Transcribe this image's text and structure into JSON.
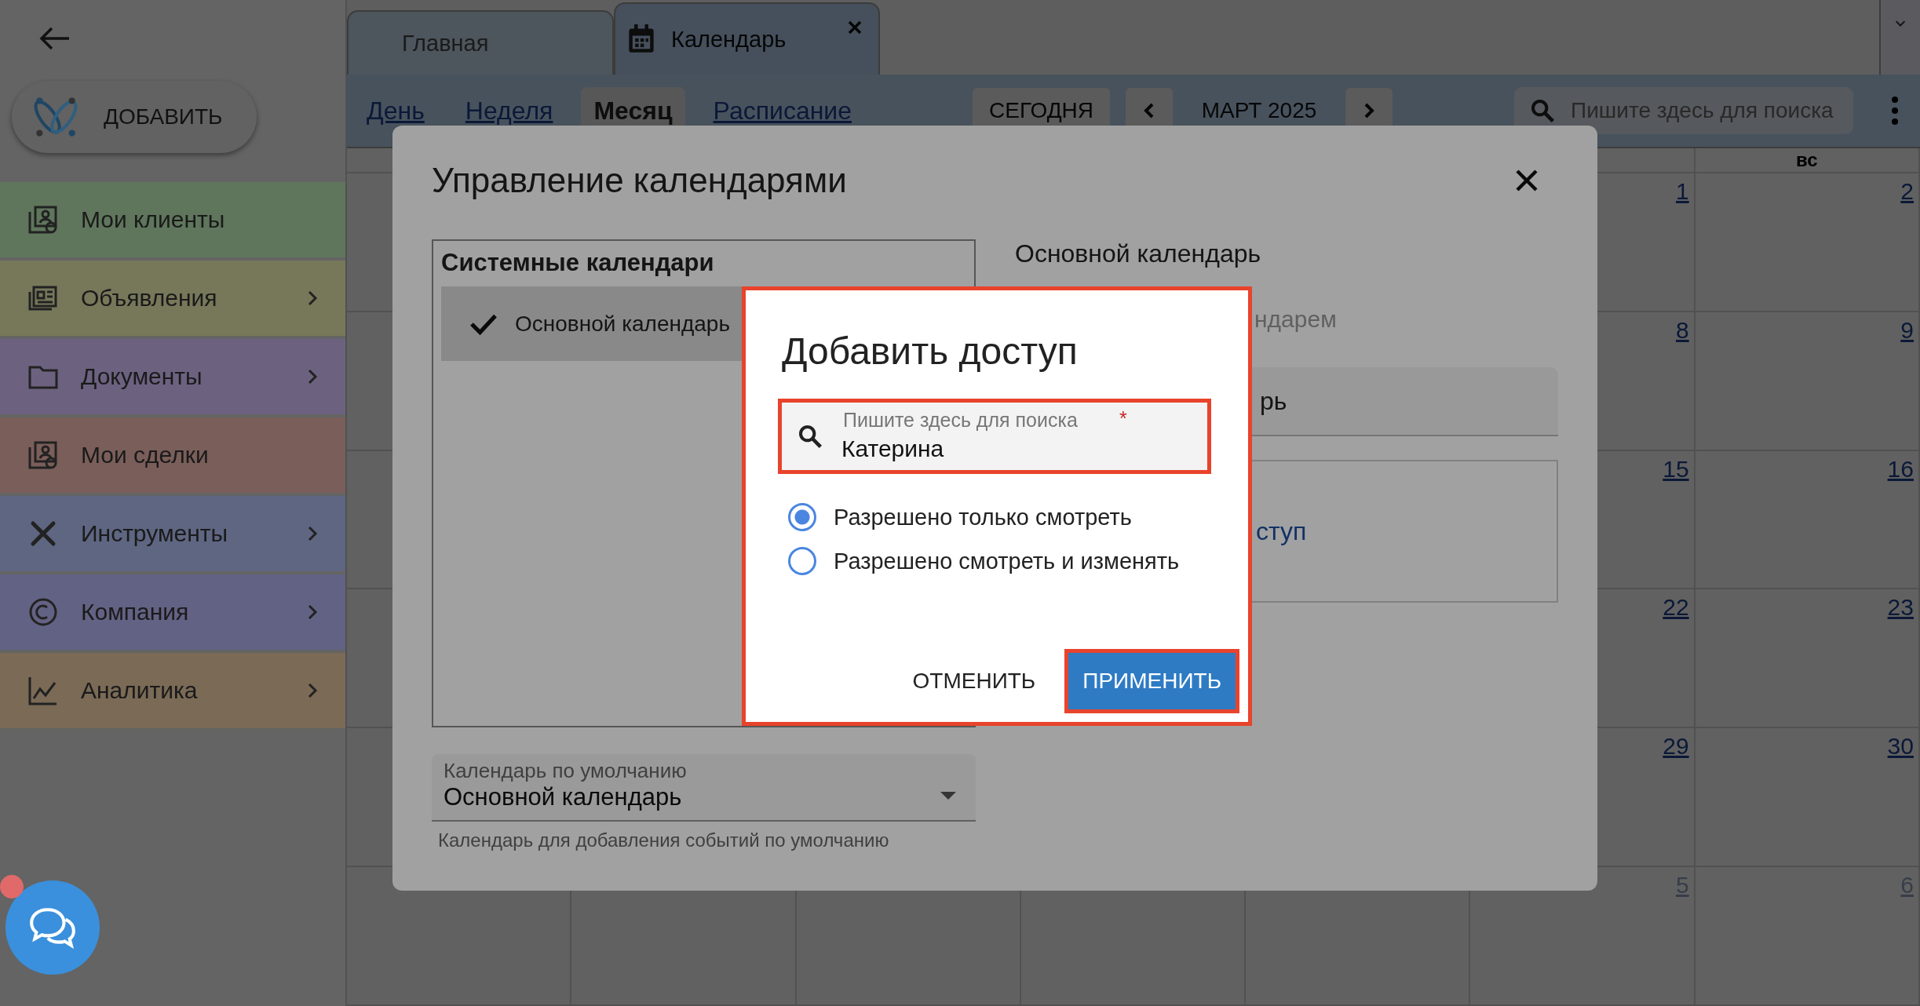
{
  "add_button": {
    "label": "ДОБАВИТЬ"
  },
  "sidebar": {
    "items": [
      {
        "label": "Мои клиенты",
        "color": "#5f765c",
        "submenu": false,
        "kind": "clients"
      },
      {
        "label": "Объявления",
        "color": "#77785a",
        "submenu": true,
        "kind": "ads"
      },
      {
        "label": "Документы",
        "color": "#6c6280",
        "submenu": true,
        "kind": "docs"
      },
      {
        "label": "Мои сделки",
        "color": "#7a5e5a",
        "submenu": false,
        "kind": "deals"
      },
      {
        "label": "Инструменты",
        "color": "#5e6682",
        "submenu": true,
        "kind": "tools"
      },
      {
        "label": "Компания",
        "color": "#626284",
        "submenu": true,
        "kind": "company"
      },
      {
        "label": "Аналитика",
        "color": "#7a6a56",
        "submenu": true,
        "kind": "analytics"
      }
    ]
  },
  "tabs": [
    {
      "label": "Главная",
      "selected": false,
      "closable": false
    },
    {
      "label": "Календарь",
      "selected": true,
      "closable": true
    }
  ],
  "views": [
    {
      "label": "День",
      "selected": false
    },
    {
      "label": "Неделя",
      "selected": false
    },
    {
      "label": "Месяц",
      "selected": true
    },
    {
      "label": "Расписание",
      "selected": false
    }
  ],
  "today_button": "СЕГОДНЯ",
  "period": "МАРТ 2025",
  "search": {
    "placeholder": "Пишите здесь для поиска"
  },
  "calendar": {
    "day_headers": {
      "sun": "вс"
    },
    "weeks": [
      {
        "sat": {
          "day": "1",
          "other_month": false
        },
        "sun": {
          "day": "2",
          "other_month": false
        }
      },
      {
        "sat": {
          "day": "8",
          "other_month": false
        },
        "sun": {
          "day": "9",
          "other_month": false
        }
      },
      {
        "sat": {
          "day": "15",
          "other_month": false
        },
        "sun": {
          "day": "16",
          "other_month": false
        }
      },
      {
        "sat": {
          "day": "22",
          "other_month": false
        },
        "sun": {
          "day": "23",
          "other_month": false
        }
      },
      {
        "sat": {
          "day": "29",
          "other_month": false
        },
        "sun": {
          "day": "30",
          "other_month": false
        }
      },
      {
        "sat": {
          "day": "5",
          "other_month": true
        },
        "sun": {
          "day": "6",
          "other_month": true
        }
      }
    ]
  },
  "manage_modal": {
    "title": "Управление календарями",
    "system_calendars": {
      "heading": "Системные календари",
      "items": [
        {
          "label": "Основной календарь",
          "selected": true
        }
      ]
    },
    "details": {
      "name": "Основной календарь",
      "subtitle_fragment": "ндарем",
      "field_fragment": "рь",
      "link_fragment": "ступ"
    },
    "default_select": {
      "label": "Календарь по умолчанию",
      "value": "Основной календарь",
      "helper": "Календарь для добавления событий по умолчанию"
    }
  },
  "access_dialog": {
    "title": "Добавить доступ",
    "highlighted": true,
    "search": {
      "label": "Пишите здесь для поиска",
      "required": true,
      "required_mark": "*",
      "value": "Катерина",
      "highlighted": true
    },
    "options": [
      {
        "label": "Разрешено только смотреть",
        "selected": true
      },
      {
        "label": "Разрешено смотреть и изменять",
        "selected": false
      }
    ],
    "buttons": [
      {
        "label": "ОТМЕНИТЬ",
        "kind": "text",
        "highlighted": false
      },
      {
        "label": "ПРИМЕНИТЬ",
        "kind": "primary",
        "highlighted": true
      }
    ]
  },
  "chat": {
    "notification": true
  }
}
